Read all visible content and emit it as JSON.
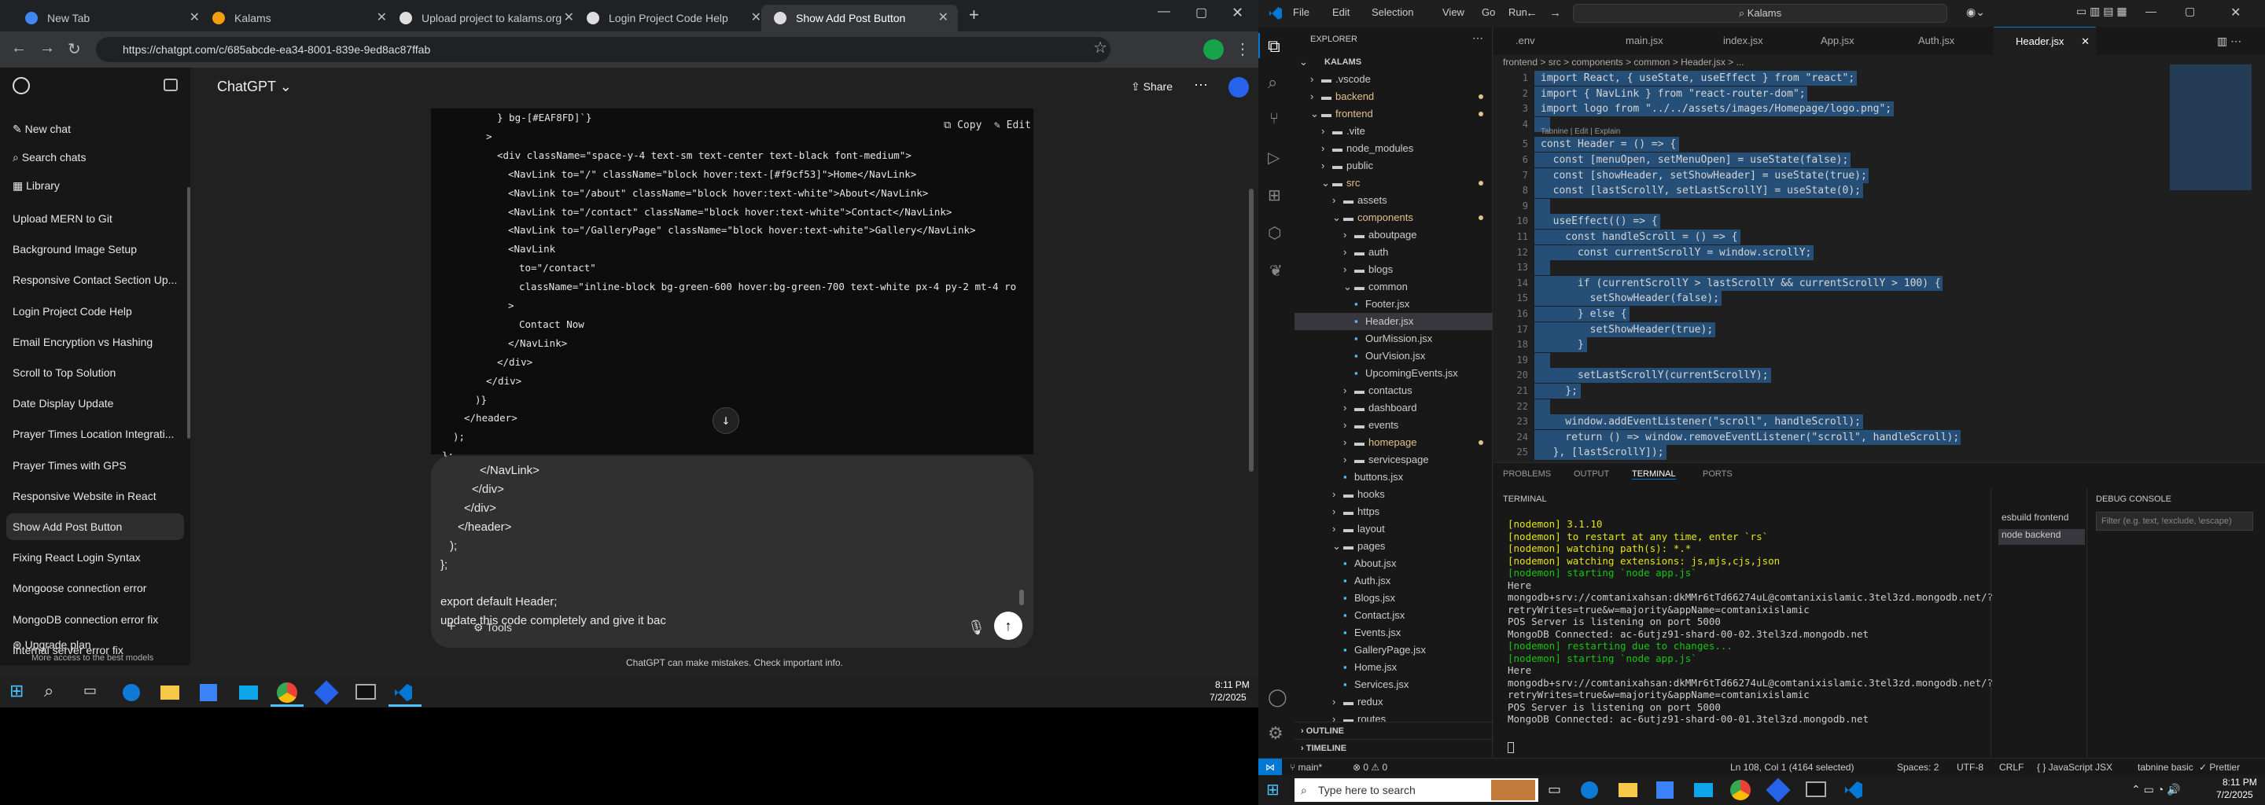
{
  "chrome": {
    "tabs": [
      {
        "label": "New Tab",
        "color": "#4285f4"
      },
      {
        "label": "Kalams",
        "color": "#f59e0b"
      },
      {
        "label": "Upload project to kalams.org",
        "color": "#10a37f"
      },
      {
        "label": "Login Project Code Help",
        "color": "#10a37f"
      },
      {
        "label": "Show Add Post Button",
        "color": "#10a37f"
      }
    ],
    "url": "https://chatgpt.com/c/685abcde-ea34-8001-839e-9ed8ac87ffab"
  },
  "chatgpt": {
    "model": "ChatGPT",
    "new_chat": "New chat",
    "search_chats": "Search chats",
    "library": "Library",
    "chats": [
      "Upload MERN to Git",
      "Background Image Setup",
      "Responsive Contact Section Up...",
      "Login Project Code Help",
      "Email Encryption vs Hashing",
      "Scroll to Top Solution",
      "Date Display Update",
      "Prayer Times Location Integrati...",
      "Prayer Times with GPS",
      "Responsive Website in React",
      "Show Add Post Button",
      "Fixing React Login Syntax",
      "Mongoose connection error",
      "MongoDB connection error fix",
      "Internal server error fix"
    ],
    "upgrade": "Upgrade plan",
    "upgrade_sub": "More access to the best models",
    "share": "Share",
    "copy": "Copy",
    "edit": "Edit",
    "code_lines": [
      {
        "t": "} bg-[#EAF8FD]`}",
        "i": 6
      },
      {
        "t": ">",
        "i": 5
      },
      {
        "t": "<div className=\"space-y-4 text-sm text-center text-black font-medium\">",
        "i": 6
      },
      {
        "t": "<NavLink to=\"/\" className=\"block hover:text-[#f9cf53]\">Home</NavLink>",
        "i": 7
      },
      {
        "t": "<NavLink to=\"/about\" className=\"block hover:text-white\">About</NavLink>",
        "i": 7
      },
      {
        "t": "<NavLink to=\"/contact\" className=\"block hover:text-white\">Contact</NavLink>",
        "i": 7
      },
      {
        "t": "<NavLink to=\"/GalleryPage\" className=\"block hover:text-white\">Gallery</NavLink>",
        "i": 7
      },
      {
        "t": "<NavLink",
        "i": 7
      },
      {
        "t": "to=\"/contact\"",
        "i": 8
      },
      {
        "t": "className=\"inline-block bg-green-600 hover:bg-green-700 text-white px-4 py-2 mt-4 ro",
        "i": 8
      },
      {
        "t": ">",
        "i": 7
      },
      {
        "t": "Contact Now",
        "i": 8
      },
      {
        "t": "</NavLink>",
        "i": 7
      },
      {
        "t": "</div>",
        "i": 6
      },
      {
        "t": "</div>",
        "i": 5
      },
      {
        "t": ")}",
        "i": 4
      },
      {
        "t": "</header>",
        "i": 3
      },
      {
        "t": ");",
        "i": 2
      },
      {
        "t": "};",
        "i": 1
      }
    ],
    "composer_lines": [
      "</NavLink>",
      "</div>",
      "</div>",
      "</header>",
      ");",
      "};",
      "",
      "export default Header;",
      "update this code completely and give it bac"
    ],
    "tools": "Tools",
    "disclaimer": "ChatGPT can make mistakes. Check important info."
  },
  "taskbar_left": {
    "time": "8:11 PM",
    "date": "7/2/2025"
  },
  "vscode": {
    "menu": [
      "File",
      "Edit",
      "Selection",
      "View",
      "Go",
      "Run"
    ],
    "search": "Kalams",
    "explorer_title": "EXPLORER",
    "tree": [
      {
        "n": "KALAMS",
        "d": 0,
        "open": true
      },
      {
        "n": ".vscode",
        "d": 1
      },
      {
        "n": "backend",
        "d": 1,
        "dot": true
      },
      {
        "n": "frontend",
        "d": 1,
        "open": true,
        "dot": true
      },
      {
        "n": ".vite",
        "d": 2
      },
      {
        "n": "node_modules",
        "d": 2
      },
      {
        "n": "public",
        "d": 2
      },
      {
        "n": "src",
        "d": 2,
        "open": true,
        "dot": true
      },
      {
        "n": "assets",
        "d": 3
      },
      {
        "n": "components",
        "d": 3,
        "open": true,
        "dot": true
      },
      {
        "n": "aboutpage",
        "d": 4
      },
      {
        "n": "auth",
        "d": 4
      },
      {
        "n": "blogs",
        "d": 4
      },
      {
        "n": "common",
        "d": 4,
        "open": true
      },
      {
        "n": "Footer.jsx",
        "d": 5,
        "f": true
      },
      {
        "n": "Header.jsx",
        "d": 5,
        "f": true,
        "sel": true
      },
      {
        "n": "OurMission.jsx",
        "d": 5,
        "f": true
      },
      {
        "n": "OurVision.jsx",
        "d": 5,
        "f": true
      },
      {
        "n": "UpcomingEvents.jsx",
        "d": 5,
        "f": true
      },
      {
        "n": "contactus",
        "d": 4
      },
      {
        "n": "dashboard",
        "d": 4
      },
      {
        "n": "events",
        "d": 4
      },
      {
        "n": "homepage",
        "d": 4,
        "dot": true
      },
      {
        "n": "servicespage",
        "d": 4
      },
      {
        "n": "buttons.jsx",
        "d": 4,
        "f": true
      },
      {
        "n": "hooks",
        "d": 3
      },
      {
        "n": "https",
        "d": 3
      },
      {
        "n": "layout",
        "d": 3
      },
      {
        "n": "pages",
        "d": 3,
        "open": true
      },
      {
        "n": "About.jsx",
        "d": 4,
        "f": true
      },
      {
        "n": "Auth.jsx",
        "d": 4,
        "f": true
      },
      {
        "n": "Blogs.jsx",
        "d": 4,
        "f": true
      },
      {
        "n": "Contact.jsx",
        "d": 4,
        "f": true
      },
      {
        "n": "Events.jsx",
        "d": 4,
        "f": true
      },
      {
        "n": "GalleryPage.jsx",
        "d": 4,
        "f": true
      },
      {
        "n": "Home.jsx",
        "d": 4,
        "f": true
      },
      {
        "n": "Services.jsx",
        "d": 4,
        "f": true
      },
      {
        "n": "redux",
        "d": 3
      },
      {
        "n": "routes",
        "d": 3
      }
    ],
    "outline": "OUTLINE",
    "timeline": "TIMELINE",
    "tabs": [
      ".env",
      "main.jsx",
      "index.jsx",
      "App.jsx",
      "Auth.jsx",
      "Header.jsx"
    ],
    "breadcrumb": "frontend > src > components > common > Header.jsx > ...",
    "code": [
      "import React, { useState, useEffect } from \"react\";",
      "import { NavLink } from \"react-router-dom\";",
      "import logo from \"../../assets/images/Homepage/logo.png\";",
      "",
      "const Header = () => {",
      "  const [menuOpen, setMenuOpen] = useState(false);",
      "  const [showHeader, setShowHeader] = useState(true);",
      "  const [lastScrollY, setLastScrollY] = useState(0);",
      "",
      "  useEffect(() => {",
      "    const handleScroll = () => {",
      "      const currentScrollY = window.scrollY;",
      "",
      "      if (currentScrollY > lastScrollY && currentScrollY > 100) {",
      "        setShowHeader(false);",
      "      } else {",
      "        setShowHeader(true);",
      "      }",
      "",
      "      setLastScrollY(currentScrollY);",
      "    };",
      "",
      "    window.addEventListener(\"scroll\", handleScroll);",
      "    return () => window.removeEventListener(\"scroll\", handleScroll);",
      "  }, [lastScrollY]);"
    ],
    "codelens": "Tabnine | Edit | Explain",
    "panel_tabs": [
      "PROBLEMS",
      "OUTPUT",
      "TERMINAL",
      "PORTS"
    ],
    "terminal_title": "TERMINAL",
    "terminal": [
      {
        "t": "[nodemon] 3.1.10",
        "c": "yellow"
      },
      {
        "t": "[nodemon] to restart at any time, enter `rs`",
        "c": "yellow"
      },
      {
        "t": "[nodemon] watching path(s): *.*",
        "c": "yellow"
      },
      {
        "t": "[nodemon] watching extensions: js,mjs,cjs,json",
        "c": "yellow"
      },
      {
        "t": "[nodemon] starting `node app.js`",
        "c": "green"
      },
      {
        "t": "Here",
        "c": ""
      },
      {
        "t": "mongodb+srv://comtanixahsan:dkMMr6tTd66274uL@comtanixislamic.3tel3zd.mongodb.net/?",
        "c": ""
      },
      {
        "t": "retryWrites=true&w=majority&appName=comtanixislamic",
        "c": ""
      },
      {
        "t": "POS Server is listening on port 5000",
        "c": ""
      },
      {
        "t": "MongoDB Connected: ac-6utjz91-shard-00-02.3tel3zd.mongodb.net",
        "c": ""
      },
      {
        "t": "[nodemon] restarting due to changes...",
        "c": "green"
      },
      {
        "t": "[nodemon] starting `node app.js`",
        "c": "green"
      },
      {
        "t": "Here",
        "c": ""
      },
      {
        "t": "mongodb+srv://comtanixahsan:dkMMr6tTd66274uL@comtanixislamic.3tel3zd.mongodb.net/?",
        "c": ""
      },
      {
        "t": "retryWrites=true&w=majority&appName=comtanixislamic",
        "c": ""
      },
      {
        "t": "POS Server is listening on port 5000",
        "c": ""
      },
      {
        "t": "MongoDB Connected: ac-6utjz91-shard-00-01.3tel3zd.mongodb.net",
        "c": ""
      }
    ],
    "terminal_list": [
      "esbuild frontend",
      "node backend"
    ],
    "debug_console": "DEBUG CONSOLE",
    "debug_filter": "Filter (e.g. text, !exclude, \\escape)",
    "status": {
      "branch": "main*",
      "errors": "⊗ 0 ⚠ 0",
      "position": "Ln 108, Col 1 (4164 selected)",
      "spaces": "Spaces: 2",
      "enc": "UTF-8",
      "eol": "CRLF",
      "lang": "{ } JavaScript JSX",
      "tabnine": "tabnine basic",
      "prettier": "✓ Prettier"
    },
    "search_taskbar": "Type here to search",
    "time": "8:11 PM",
    "date": "7/2/2025"
  }
}
